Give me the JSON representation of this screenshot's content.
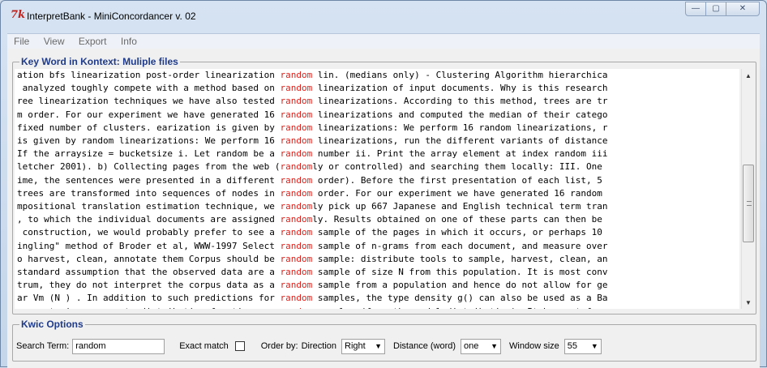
{
  "window": {
    "title": "InterpretBank - MiniConcordancer v. 02",
    "app_icon_glyph": "7k",
    "controls": {
      "minimize": "—",
      "maximize": "▢",
      "close": "✕"
    }
  },
  "menu": [
    "File",
    "View",
    "Export",
    "Info"
  ],
  "kwic": {
    "group_title": "Key Word in Kontext: Muliple files",
    "lines": [
      {
        "left": "ation bfs linearization post-order linearization ",
        "kw": "random",
        "right": " lin. (medians only) - Clustering Algorithm hierarchica"
      },
      {
        "left": " analyzed toughly compete with a method based on ",
        "kw": "random",
        "right": " linearization of input documents. Why is this research"
      },
      {
        "left": "ree linearization techniques we have also tested ",
        "kw": "random",
        "right": " linearizations. According to this method, trees are tr"
      },
      {
        "left": "m order. For our experiment we have generated 16 ",
        "kw": "random",
        "right": " linearizations and computed the median of their catego"
      },
      {
        "left": "fixed number of clusters. earization is given by ",
        "kw": "random",
        "right": " linearizations: We perform 16 random linearizations, r"
      },
      {
        "left": "is given by random linearizations: We perform 16 ",
        "kw": "random",
        "right": " linearizations, run the different variants of distance"
      },
      {
        "left": "If the arraysize = bucketsize i. Let random be a ",
        "kw": "random",
        "right": " number ii. Print the array element at index random iii"
      },
      {
        "left": "letcher 2001). b) Collecting pages from the web (",
        "kw": "random",
        "right": "ly or controlled) and searching them locally: III. One"
      },
      {
        "left": "ime, the sentences were presented in a different ",
        "kw": "random",
        "right": " order). Before the first presentation of each list, 5"
      },
      {
        "left": "trees are transformed into sequences of nodes in ",
        "kw": "random",
        "right": " order. For our experiment we have generated 16 random"
      },
      {
        "left": "mpositional translation estimation technique, we ",
        "kw": "random",
        "right": "ly pick up 667 Japanese and English technical term tran"
      },
      {
        "left": ", to which the individual documents are assigned ",
        "kw": "random",
        "right": "ly. Results obtained on one of these parts can then be"
      },
      {
        "left": " construction, we would probably prefer to see a ",
        "kw": "random",
        "right": " sample of the pages in which it occurs, or perhaps 10"
      },
      {
        "left": "ingling\" method of Broder et al, WWW-1997 Select ",
        "kw": "random",
        "right": " sample of n-grams from each document, and measure over"
      },
      {
        "left": "o harvest, clean, annotate them Corpus should be ",
        "kw": "random",
        "right": " sample: distribute tools to sample, harvest, clean, an"
      },
      {
        "left": "standard assumption that the observed data are a ",
        "kw": "random",
        "right": " sample of size N from this population. It is most conv"
      },
      {
        "left": "trum, they do not interpret the corpus data as a ",
        "kw": "random",
        "right": " sample from a population and hence do not allow for ge"
      },
      {
        "left": "ar Vm (N ) . In addition to such predictions for ",
        "kw": "random",
        "right": " samples, the type density g() can also be used as a Ba"
      },
      {
        "left": "oes not give access to distribution functions or ",
        "kw": "random",
        "right": " samples (from the model distribution). It has not foun"
      }
    ]
  },
  "options": {
    "group_title": "Kwic Options",
    "search_label": "Search Term:",
    "search_value": "random",
    "exact_match_label": "Exact match",
    "order_by_label": "Order by:",
    "direction_label": "Direction",
    "direction_value": "Right",
    "distance_label": "Distance (word)",
    "distance_value": "one",
    "window_size_label": "Window size",
    "window_size_value": "55"
  }
}
